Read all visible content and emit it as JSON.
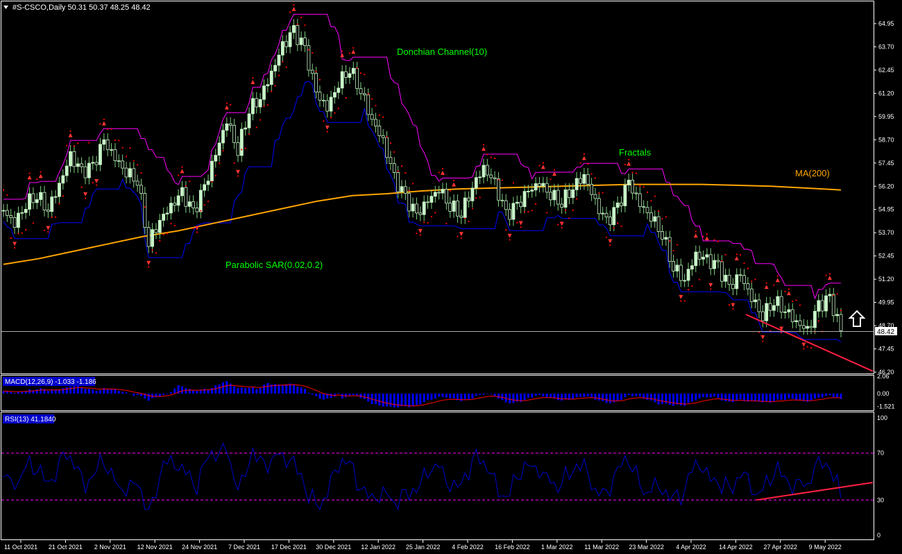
{
  "header": {
    "symbol_line": "#S-CSCO,Daily  50.31 50.37 48.25 48.42"
  },
  "colors": {
    "background": "#000000",
    "frame": "#ffffff",
    "candle_bull": "#c8f5c8",
    "candle_bear": "#ffffff",
    "donchian_upper": "#ff00ff",
    "donchian_lower": "#0000ff",
    "ma200": "#ffa500",
    "sar": "#ff0000",
    "fractal": "#ff3333",
    "macd_hist": "#0000ff",
    "macd_signal": "#ff0000",
    "rsi_line": "#0000cd",
    "rsi_levels": "#ff00ff",
    "trendline": "#ff2040",
    "annotation_text": "#00ff00",
    "ma_label": "#ffa500"
  },
  "annotations": {
    "donchian_label": "Donchian Channel(10)",
    "fractals_label": "Fractals",
    "ma_label": "MA(200)",
    "sar_label": "Parabolic SAR(0.02,0.2)"
  },
  "chart_data": [
    {
      "type": "candlestick",
      "name": "#S-CSCO,Daily",
      "ohlc_last": {
        "open": 50.31,
        "high": 50.37,
        "low": 48.25,
        "close": 48.42
      },
      "current_price_label": "48.42",
      "ylim": [
        46.2,
        65.55
      ],
      "y_ticks": [
        "64.95",
        "63.70",
        "62.45",
        "61.20",
        "59.95",
        "58.70",
        "57.45",
        "56.20",
        "54.95",
        "53.70",
        "52.45",
        "51.20",
        "49.95",
        "48.70",
        "47.45",
        "46.20"
      ],
      "x_ticks": [
        "11 Oct 2021",
        "21 Oct 2021",
        "2 Nov 2021",
        "12 Nov 2021",
        "24 Nov 2021",
        "7 Dec 2021",
        "17 Dec 2021",
        "30 Dec 2021",
        "12 Jan 2022",
        "25 Jan 2022",
        "4 Feb 2022",
        "16 Feb 2022",
        "1 Mar 2022",
        "11 Mar 2022",
        "23 Mar 2022",
        "4 Apr 2022",
        "14 Apr 2022",
        "27 Apr 2022",
        "9 May 2022"
      ],
      "close_path": [
        54.9,
        54.2,
        55.3,
        55.8,
        55.0,
        56.3,
        57.8,
        56.9,
        57.2,
        58.6,
        57.7,
        57.0,
        56.6,
        53.2,
        54.4,
        55.1,
        55.8,
        54.7,
        56.1,
        57.9,
        59.8,
        58.2,
        60.4,
        61.0,
        62.3,
        63.7,
        64.5,
        63.5,
        61.2,
        60.4,
        61.8,
        62.6,
        61.4,
        59.8,
        58.6,
        56.6,
        55.5,
        54.6,
        55.4,
        56.1,
        55.2,
        54.8,
        56.2,
        57.2,
        56.3,
        54.6,
        55.1,
        55.9,
        56.4,
        55.8,
        55.4,
        56.2,
        56.8,
        55.3,
        54.2,
        55.0,
        56.4,
        55.2,
        54.6,
        53.7,
        51.9,
        51.2,
        52.5,
        52.2,
        51.8,
        50.7,
        51.4,
        50.2,
        49.3,
        50.1,
        49.6,
        48.9,
        48.4,
        49.7,
        50.1,
        48.42
      ],
      "ma200_path": [
        52.0,
        52.3,
        52.7,
        53.1,
        53.5,
        53.8,
        54.2,
        54.6,
        55.0,
        55.4,
        55.7,
        55.8,
        55.95,
        56.05,
        56.1,
        56.15,
        56.2,
        56.25,
        56.3,
        56.3,
        56.3,
        56.25,
        56.2,
        56.1,
        56.0
      ]
    },
    {
      "type": "line",
      "name": "MACD(12,26,9)",
      "header": "MACD(12,26,9) -1.033 -1.186",
      "y_ticks": [
        "2.06",
        "0.00",
        "-1.521"
      ],
      "signal_last": -1.186,
      "macd_last": -1.033,
      "ylim": [
        -1.9,
        2.06
      ]
    },
    {
      "type": "line",
      "name": "RSI(13)",
      "header": "RSI(13) 41.1840",
      "y_ticks": [
        "100",
        "70",
        "30",
        "0"
      ],
      "levels": [
        70,
        30
      ],
      "last": 41.184,
      "ylim": [
        0,
        100
      ]
    }
  ]
}
